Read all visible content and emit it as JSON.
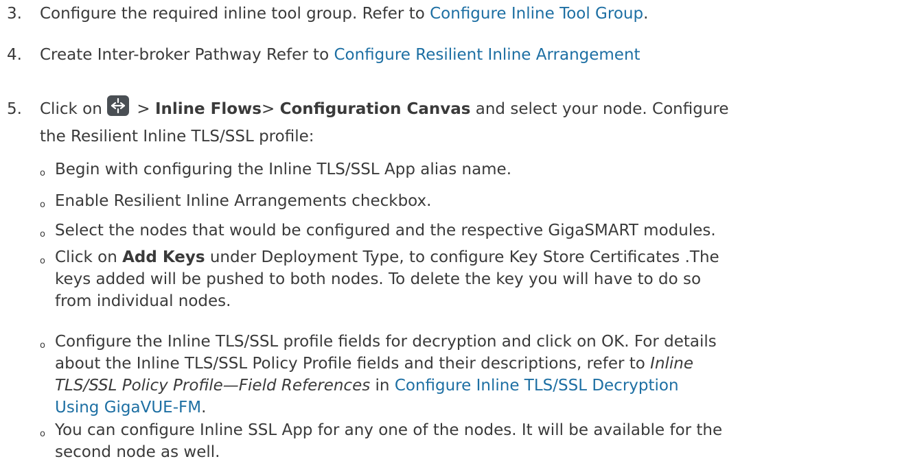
{
  "steps": [
    {
      "num": "3.",
      "pre": "Configure the required inline tool group. Refer to ",
      "link": "Configure Inline Tool Group",
      "post": "."
    },
    {
      "num": "4.",
      "pre": "Create Inter-broker Pathway Refer to ",
      "link": "Configure Resilient Inline Arrangement",
      "post": ""
    },
    {
      "num": "5.",
      "pre": "Click on",
      "icon": "inline-flows-icon",
      "sep1": " > ",
      "bold1": "Inline Flows",
      "sep2": "> ",
      "bold2": "Configuration Canvas",
      "tail": " and select your node. Configure",
      "line2": "the Resilient Inline TLS/SSL profile:"
    }
  ],
  "bullet_char": "o",
  "subitems": {
    "item1": "Begin with configuring the Inline TLS/SSL App alias name.",
    "item2": "Enable Resilient Inline Arrangements checkbox.",
    "item3": "Select the nodes that would be configured and the respective GigaSMART modules.",
    "item4": {
      "pre": "Click on ",
      "bold": "Add Keys",
      "line1_rest": " under Deployment Type, to configure Key Store Certificates .The",
      "line2": "keys added will be pushed to both nodes. To delete the key you will have to do so",
      "line3": "from individual nodes."
    },
    "item5": {
      "line1": "Configure the Inline TLS/SSL profile fields for decryption and click on OK. For details",
      "line2": "about the Inline TLS/SSL Policy Profile fields and their descriptions, refer to ",
      "line2_italic": "Inline",
      "line3_italic": "TLS/SSL Policy Profile—Field References",
      "line3_mid": " in ",
      "line3_link": "Configure Inline TLS/SSL Decryption",
      "line4_link": "Using GigaVUE-FM",
      "line4_post": "."
    },
    "item6": {
      "line1": "You can configure Inline SSL App for any one of the nodes. It will be available for the",
      "line2": "second node as well."
    }
  }
}
